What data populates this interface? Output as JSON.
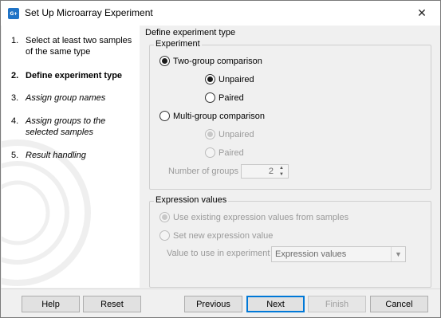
{
  "window": {
    "title": "Set Up Microarray Experiment",
    "app_icon": "clc-workbench-icon",
    "app_icon_text": "G+"
  },
  "sidebar": {
    "steps": [
      {
        "num": "1.",
        "label": "Select at least two samples of the same type",
        "state": "done"
      },
      {
        "num": "2.",
        "label": "Define experiment type",
        "state": "current"
      },
      {
        "num": "3.",
        "label": "Assign group names",
        "state": "future"
      },
      {
        "num": "4.",
        "label": "Assign groups to the selected samples",
        "state": "future"
      },
      {
        "num": "5.",
        "label": "Result handling",
        "state": "future"
      }
    ]
  },
  "main": {
    "title": "Define experiment type",
    "experiment": {
      "label": "Experiment",
      "two_group": "Two-group comparison",
      "unpaired": "Unpaired",
      "paired": "Paired",
      "multi_group": "Multi-group comparison",
      "multi_unpaired": "Unpaired",
      "multi_paired": "Paired",
      "num_groups_label": "Number of groups",
      "num_groups_value": "2"
    },
    "expression": {
      "label": "Expression values",
      "use_existing": "Use existing expression values from samples",
      "set_new": "Set new expression value",
      "value_label": "Value to use in experiment",
      "value_selected": "Expression values"
    }
  },
  "buttons": {
    "help": "Help",
    "reset": "Reset",
    "previous": "Previous",
    "next": "Next",
    "finish": "Finish",
    "cancel": "Cancel"
  },
  "colors": {
    "accent": "#0078d7",
    "icon_blue": "#1f73c6"
  }
}
